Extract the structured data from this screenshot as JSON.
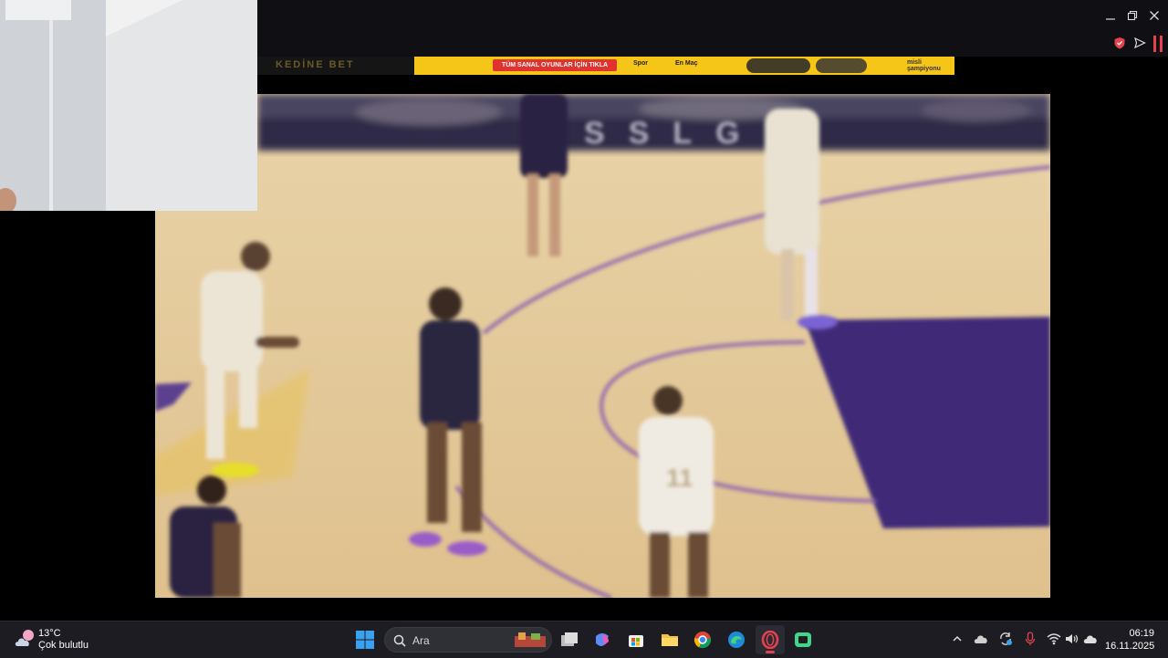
{
  "window": {
    "controls": {
      "minimize": "minimize",
      "maximize": "restore",
      "close": "close"
    }
  },
  "ad": {
    "left_text": "KEDİNE BET",
    "cta_text": "TÜM SANAL OYUNLAR İÇİN TIKLA",
    "item_1": "Spor",
    "item_2": "En Maç",
    "brand": "misli şampiyonu"
  },
  "video": {
    "court_text": "SSLG"
  },
  "taskbar": {
    "weather": {
      "temp": "13°C",
      "desc": "Çok bulutlu",
      "icon": "cloud-sun-icon"
    },
    "search": {
      "label": "Ara"
    },
    "clock": {
      "time": "06:19",
      "date": "16.11.2025"
    }
  },
  "colors": {
    "court": "#e4c998",
    "paint": "#3f2a78",
    "accent": "#e4424e"
  }
}
